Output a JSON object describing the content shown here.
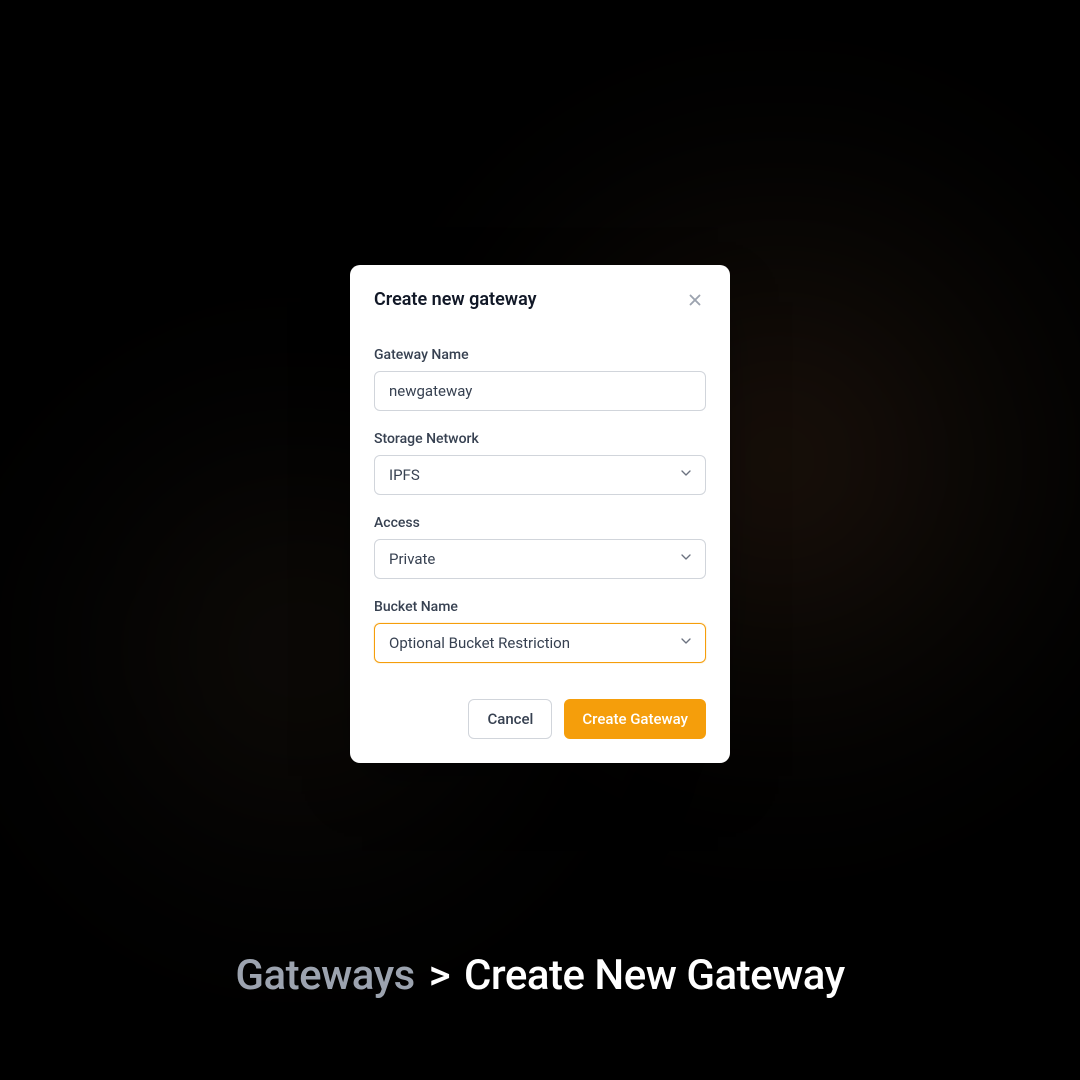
{
  "modal": {
    "title": "Create new gateway",
    "fields": {
      "gateway_name": {
        "label": "Gateway Name",
        "value": "newgateway"
      },
      "storage_network": {
        "label": "Storage Network",
        "value": "IPFS"
      },
      "access": {
        "label": "Access",
        "value": "Private"
      },
      "bucket_name": {
        "label": "Bucket Name",
        "placeholder": "Optional Bucket Restriction"
      }
    },
    "buttons": {
      "cancel": "Cancel",
      "submit": "Create Gateway"
    }
  },
  "breadcrumb": {
    "parent": "Gateways",
    "separator": ">",
    "current": "Create New Gateway"
  },
  "colors": {
    "accent": "#f59e0b"
  }
}
